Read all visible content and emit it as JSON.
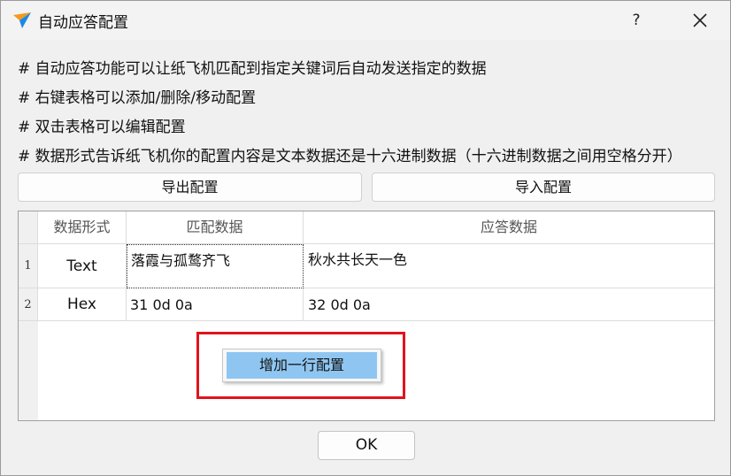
{
  "window": {
    "title": "自动应答配置",
    "help_label": "?",
    "close_label": "✕"
  },
  "description": [
    "# 自动应答功能可以让纸飞机匹配到指定关键词后自动发送指定的数据",
    "# 右键表格可以添加/删除/移动配置",
    "# 双击表格可以编辑配置",
    "# 数据形式告诉纸飞机你的配置内容是文本数据还是十六进制数据（十六进制数据之间用空格分开）"
  ],
  "toolbar": {
    "export_label": "导出配置",
    "import_label": "导入配置"
  },
  "table": {
    "headers": [
      "数据形式",
      "匹配数据",
      "应答数据"
    ],
    "rows": [
      {
        "num": "1",
        "format": "Text",
        "match": "落霞与孤鹜齐飞",
        "reply": "秋水共长天一色"
      },
      {
        "num": "2",
        "format": "Hex",
        "match": "31 0d 0a",
        "reply": "32 0d 0a"
      }
    ]
  },
  "context_menu": {
    "items": [
      "增加一行配置"
    ]
  },
  "footer": {
    "ok_label": "OK"
  },
  "colors": {
    "highlight": "#e0141c",
    "menu_selected": "#8fc6f1"
  }
}
